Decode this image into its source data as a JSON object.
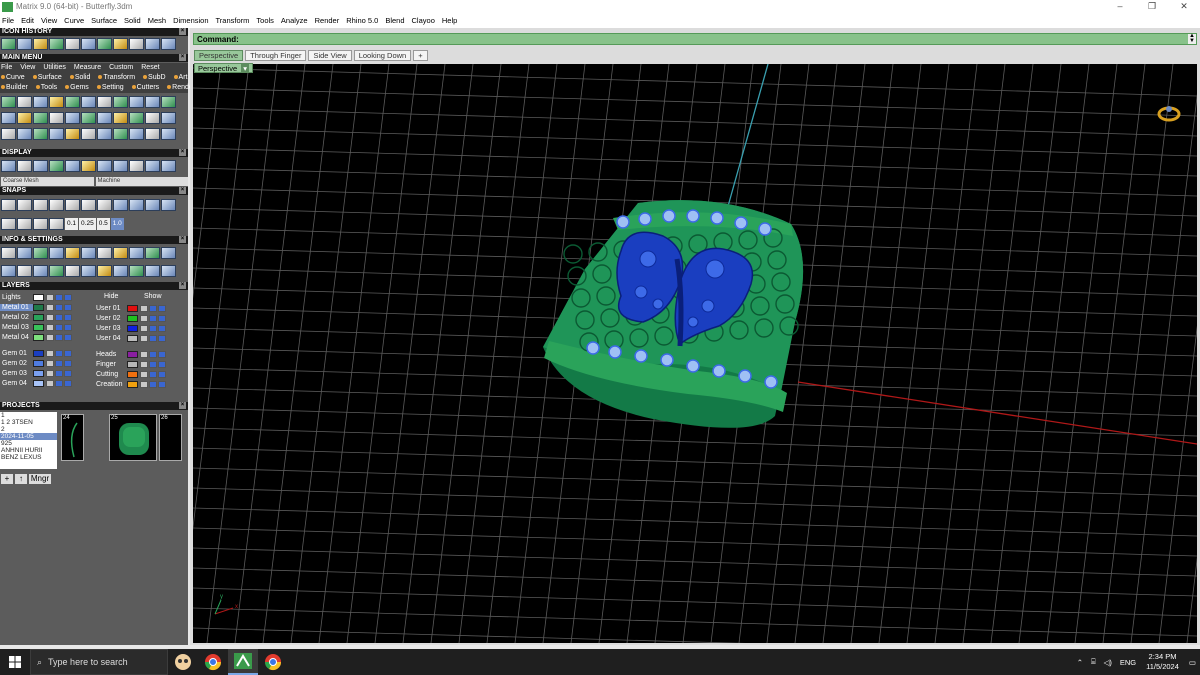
{
  "window": {
    "title": "Matrix 9.0 (64-bit) - Butterfly.3dm",
    "minimize": "–",
    "maximize": "❐",
    "close": "✕"
  },
  "menubar": [
    "File",
    "Edit",
    "View",
    "Curve",
    "Surface",
    "Solid",
    "Mesh",
    "Dimension",
    "Transform",
    "Tools",
    "Analyze",
    "Render",
    "Rhino 5.0",
    "Blend",
    "Clayoo",
    "Help"
  ],
  "panels": {
    "icon_history": "ICON HISTORY",
    "main_menu": "MAIN MENU",
    "display": "DISPLAY",
    "snaps": "SNAPS",
    "info_settings": "INFO & SETTINGS",
    "layers": "LAYERS",
    "projects": "PROJECTS"
  },
  "main_menu": {
    "row1": [
      "File",
      "View",
      "Utilities",
      "Measure",
      "Custom",
      "Reset"
    ],
    "row2": [
      "Curve",
      "Surface",
      "Solid",
      "Transform",
      "SubD",
      "Art"
    ],
    "row3": [
      "Builder",
      "Tools",
      "Gems",
      "Setting",
      "Cutters",
      "Render"
    ]
  },
  "display": {
    "coarse": "Coarse Mesh",
    "machine": "Machine"
  },
  "snaps": {
    "values": [
      "0.1",
      "0.25",
      "0.5",
      "1.0"
    ]
  },
  "layers": {
    "hide": "Hide",
    "show": "Show",
    "left": [
      {
        "name": "Lights",
        "color": "#ffffff"
      },
      {
        "name": "Metal 01",
        "color": "#1f7a4a",
        "selected": true
      },
      {
        "name": "Metal 02",
        "color": "#2aa35a"
      },
      {
        "name": "Metal 03",
        "color": "#39c25a"
      },
      {
        "name": "Metal 04",
        "color": "#7ee07e"
      },
      {
        "name": "Gem 01",
        "color": "#1a3ec0"
      },
      {
        "name": "Gem 02",
        "color": "#4f7ce0"
      },
      {
        "name": "Gem 03",
        "color": "#7aa0f0"
      },
      {
        "name": "Gem 04",
        "color": "#a8c4f8"
      }
    ],
    "right": [
      {
        "name": "User 01",
        "color": "#e01010"
      },
      {
        "name": "User 02",
        "color": "#20c020"
      },
      {
        "name": "User 03",
        "color": "#1020e0"
      },
      {
        "name": "User 04",
        "color": "#bbbbbb"
      },
      {
        "name": "Heads",
        "color": "#8a1ea0"
      },
      {
        "name": "Finger",
        "color": "#b8b8b8"
      },
      {
        "name": "Cutting",
        "color": "#f07010"
      },
      {
        "name": "Creation",
        "color": "#f0a010"
      }
    ]
  },
  "projects": {
    "list": [
      "1",
      "1 2 3TSEN",
      "2",
      "2024-11-05",
      "925",
      "ANHNII HURII",
      "BENZ LEXUS"
    ],
    "selected_index": 3,
    "thumbs": [
      "24",
      "25",
      "26"
    ],
    "buttons": {
      "add": "+",
      "up": "↑",
      "mngr": "Mngr"
    }
  },
  "command": {
    "label": "Command:"
  },
  "viewport_tabs": [
    "Perspective",
    "Through Finger",
    "Side View",
    "Looking Down",
    "+"
  ],
  "active_viewport": "Perspective",
  "viewport_axis": {
    "x": "x",
    "y": "y"
  },
  "taskbar": {
    "search_placeholder": "Type here to search",
    "tray_lang": "ENG",
    "time": "2:34 PM",
    "date": "11/5/2024"
  },
  "colors": {
    "ring_metal": "#1f8a4e",
    "gem_blue": "#2a4fd6",
    "grid": "#5a5a5a",
    "command_green": "#88c28a"
  },
  "icons": [
    "windows-start-icon",
    "search-icon",
    "chrome-icon",
    "matrix-app-icon",
    "chevron-up-icon",
    "network-icon",
    "volume-icon",
    "notifications-icon",
    "navigation-widget-icon"
  ]
}
